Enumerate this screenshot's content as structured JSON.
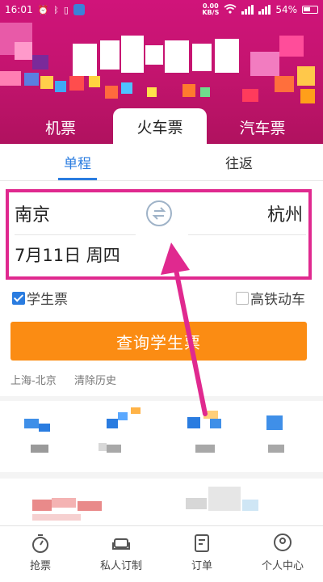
{
  "status_bar": {
    "time": "16:01",
    "net_speed_value": "0.00",
    "net_speed_unit": "KB/S",
    "battery": "54%",
    "signal": "4G"
  },
  "mode_tabs": [
    "机票",
    "火车票",
    "汽车票"
  ],
  "trip_tabs": [
    "单程",
    "往返"
  ],
  "route": {
    "from": "南京",
    "to": "杭州",
    "date": "7月11日 周四"
  },
  "options": {
    "student": "学生票",
    "high_speed": "高铁动车"
  },
  "search_button": "查询学生票",
  "history": {
    "item": "上海-北京",
    "clear": "清除历史"
  },
  "bottom_nav": [
    "抢票",
    "私人订制",
    "订单",
    "个人中心"
  ],
  "colors": {
    "brand_magenta": "#c51470",
    "accent_blue": "#2a7ce0",
    "search_orange": "#fb8c13",
    "annotation": "#e0298f"
  }
}
